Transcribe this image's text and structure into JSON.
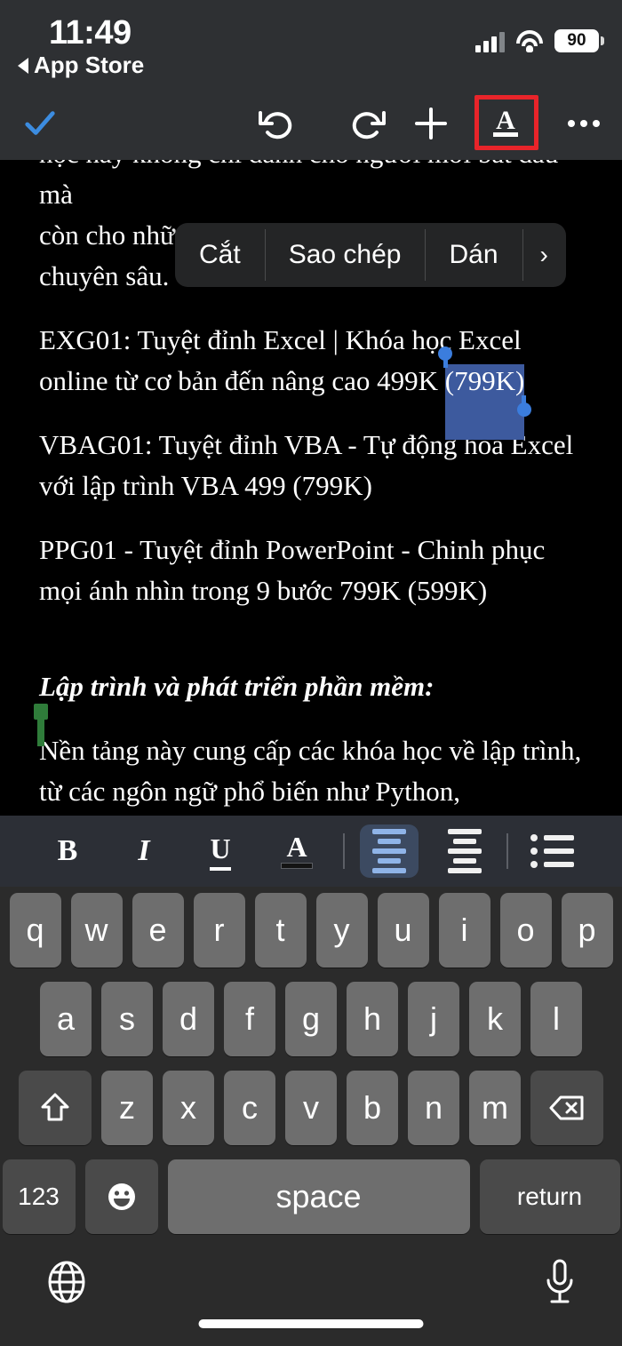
{
  "status_bar": {
    "time": "11:49",
    "back_label": "App Store",
    "battery_level": "90",
    "icons": [
      "cellular-signal-icon",
      "wifi-icon",
      "battery-icon"
    ]
  },
  "app_toolbar": {
    "done_label": "check-icon",
    "items": [
      {
        "name": "undo-button",
        "label": "undo-icon"
      },
      {
        "name": "redo-button",
        "label": "redo-icon"
      },
      {
        "name": "insert-button",
        "label": "plus-icon"
      },
      {
        "name": "format-button",
        "label": "text-format-icon",
        "highlighted": true
      },
      {
        "name": "more-button",
        "label": "ellipsis-icon"
      }
    ],
    "highlight_color": "#e8242a"
  },
  "context_menu": {
    "items": [
      "Cắt",
      "Sao chép",
      "Dán"
    ],
    "more_chevron": "›"
  },
  "document": {
    "paragraphs": [
      {
        "id": "line-clipped",
        "text": "học này không chỉ dành cho người mới bắt đầu mà"
      },
      {
        "id": "para-1",
        "text": "còn cho những người muốn nâng cao kỹ năng chuyên sâu."
      },
      {
        "id": "para-2-pre",
        "text": "EXG01: Tuyệt đỉnh Excel | Khóa học Excel online từ cơ bản đến nâng cao 499K "
      },
      {
        "id": "para-2-selected",
        "text": "(799K)"
      },
      {
        "id": "para-3",
        "text": "VBAG01: Tuyệt đỉnh VBA - Tự động hóa Excel với lập trình VBA 499 (799K)"
      },
      {
        "id": "para-4",
        "text": "PPG01 - Tuyệt đỉnh PowerPoint - Chinh phục mọi ánh nhìn trong 9 bước 799K (599K)"
      }
    ],
    "heading_green": "Lập trình và phát triển phần mềm:",
    "heading_color": "#bff0a8",
    "body_after_heading": "Nền tảng này cung cấp các khóa học về lập trình, từ các ngôn ngữ phổ biến như Python, JavaScript, Java đến các kỹ thuật phát triển web, ứng dụng di động và các hệ thống quản lý dữ liệu.",
    "selection_color": "#3d5a9e",
    "caret_color": "#2f7c3a"
  },
  "format_bar": {
    "buttons": [
      {
        "name": "bold-button",
        "label": "B"
      },
      {
        "name": "italic-button",
        "label": "I"
      },
      {
        "name": "underline-button",
        "label": "U"
      },
      {
        "name": "text-color-button",
        "label": "A"
      },
      {
        "name": "align-left-button",
        "label": "align-left-icon",
        "active": true
      },
      {
        "name": "align-center-button",
        "label": "align-center-icon"
      },
      {
        "name": "bullet-list-button",
        "label": "bullet-list-icon"
      }
    ],
    "active_bg": "#3c4a61",
    "active_fg": "#8fb4e8"
  },
  "keyboard": {
    "row1": [
      "q",
      "w",
      "e",
      "r",
      "t",
      "y",
      "u",
      "i",
      "o",
      "p"
    ],
    "row2": [
      "a",
      "s",
      "d",
      "f",
      "g",
      "h",
      "j",
      "k",
      "l"
    ],
    "row3": [
      "z",
      "x",
      "c",
      "v",
      "b",
      "n",
      "m"
    ],
    "shift_label": "shift-icon",
    "backspace_label": "backspace-icon",
    "numbers_label": "123",
    "emoji_label": "emoji-icon",
    "space_label": "space",
    "return_label": "return",
    "globe_label": "globe-icon",
    "mic_label": "microphone-icon"
  }
}
